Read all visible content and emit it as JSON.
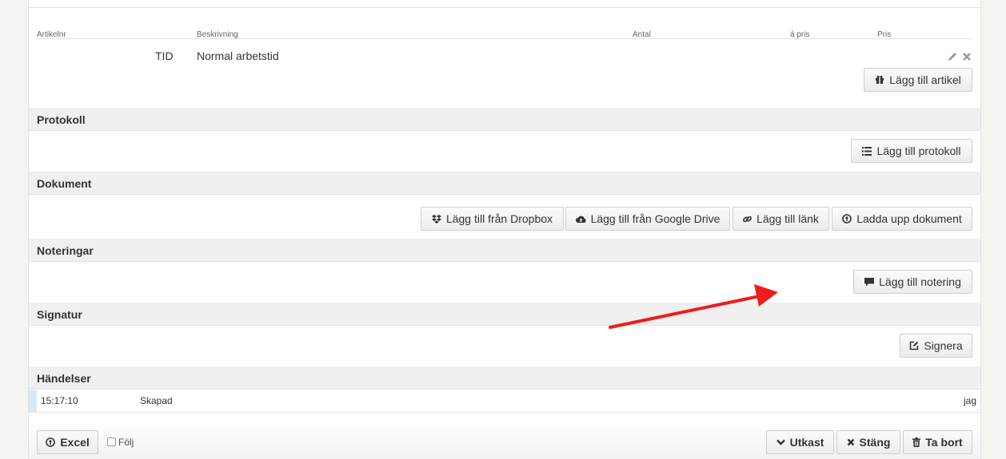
{
  "table": {
    "headers": {
      "artikelnr": "Artikelnr",
      "beskrivning": "Beskrivning",
      "antal": "Antal",
      "apris": "á pris",
      "pris": "Pris"
    },
    "rows": [
      {
        "code": "TID",
        "description": "Normal arbetstid"
      }
    ],
    "add_article_label": "Lägg till artikel"
  },
  "sections": {
    "protokoll": {
      "title": "Protokoll",
      "add_label": "Lägg till protokoll"
    },
    "dokument": {
      "title": "Dokument",
      "dropbox_label": "Lägg till från Dropbox",
      "google_label": "Lägg till från Google Drive",
      "link_label": "Lägg till länk",
      "upload_label": "Ladda upp dokument"
    },
    "noteringar": {
      "title": "Noteringar",
      "add_label": "Lägg till notering"
    },
    "signatur": {
      "title": "Signatur",
      "sign_label": "Signera"
    },
    "handelser": {
      "title": "Händelser",
      "events": [
        {
          "time": "15:17:10",
          "action": "Skapad",
          "user": "jag"
        }
      ]
    }
  },
  "footer": {
    "excel_label": "Excel",
    "follow_label": "Följ",
    "draft_label": "Utkast",
    "close_label": "Stäng",
    "delete_label": "Ta bort"
  },
  "icons": {
    "edit": "pencil-icon",
    "remove": "x-icon",
    "article": "gift-icon",
    "list": "list-icon",
    "dropbox": "dropbox-icon",
    "drive": "cloud-upload-icon",
    "link": "link-icon",
    "upload": "upload-circle-icon",
    "comment": "comment-icon",
    "sign": "edit-square-icon",
    "draft": "chevron-down-icon",
    "close": "x-icon",
    "trash": "trash-icon"
  },
  "colors": {
    "annotation_arrow": "#ee1c1c",
    "section_bg": "#f0f0f0",
    "event_marker": "#cfe3f5"
  }
}
